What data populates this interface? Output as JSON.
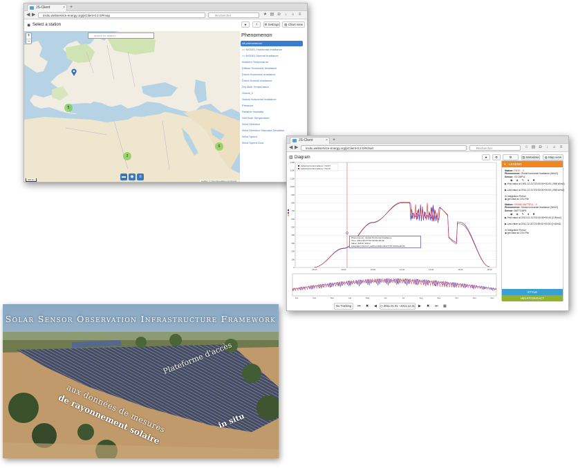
{
  "map_window": {
    "tab_title": "JS-Client",
    "url": "insitu.webservice-energy.org/jsClient-0.2.0/#map",
    "search_placeholder": "Rechercher",
    "header_title": "Select a station",
    "buttons": {
      "star": "★",
      "help": "?",
      "settings": "Settings",
      "chart_view": "Chart view"
    },
    "map_search_placeholder": "search for station...",
    "zoom_in": "+",
    "zoom_out": "−",
    "clusters": [
      "5",
      "2",
      "6"
    ],
    "attribution": "Leaflet | © OpenStreetMap contributors",
    "scale": "300 km",
    "phenomenon_title": "Phenomenon",
    "phenomena": [
      "All phenomenon",
      ">> MODEL Horizontal Irradiance",
      ">> MODEL Normal Irradiance",
      "Ambient Temperature",
      "Diffuse Horizontal Irradiance",
      "Direct Horizontal Irradiance",
      "Direct Normal Irradiance",
      "Dry Bulb Temperature",
      "Global_2",
      "Global Horizontal Irradiance",
      "Pressure",
      "Relative Humidity",
      "Wet Bulb Temperature",
      "Wind Direction",
      "Wind Direction Standard Deviation",
      "Wind Speed",
      "Wind Speed Gust"
    ]
  },
  "diagram_window": {
    "tab_title": "JS-Client",
    "url": "insitu.webservice-energy.org/jsClient-0.2.0/#chart",
    "search_placeholder": "Rechercher",
    "header_title": "Diagram",
    "buttons": {
      "star": "★",
      "gear": "⚙",
      "settings": "Settings",
      "metadata": "Metadata",
      "map_view": "Map view"
    },
    "legend_title": "LEGEND",
    "legend_bar2": "STYLE",
    "legend_bar3": "HELP/CONTACT",
    "legend_entries": [
      {
        "station_label": "Station:",
        "station": "ENTE - X",
        "phenomenon_label": "Phenomenon:",
        "phenomenon": "Global horizontal Irradiance (W/m2)",
        "sensor_label": "Sensor:",
        "sensor": "X3 CMP11",
        "first": "First value at 1991-12-31T23:00:00+00:00 (.998 W/m2)",
        "last": "Last value at 2014-12-31T23:00:00+00:00 (.998 W/m2)",
        "integration": "Integration Period",
        "csv": "get data as CSV-File"
      },
      {
        "station_label": "Station:",
        "station": "GRAND BATTEUL - X",
        "phenomenon_label": "Phenomenon:",
        "phenomenon": "Global horizontal Irradiance (W/m2)",
        "sensor_label": "Sensor:",
        "sensor": "BATTCMP6",
        "first": "First value at 2013-12-31T23:00:00+00:00 (0 W/m2)",
        "last": "Last value at 2011-12-31T23:59:00+00:00 (0 W/m2)",
        "integration": "Integration Period",
        "csv": "get data as CSV-File"
      }
    ],
    "chart_legend": [
      "Global Horizontal Irradiance = 519.87",
      "Global Horizontal Irradiance = 511.26"
    ],
    "tooltip": {
      "phenomenon": "Phenomenon: Global Horizontal Irradiance",
      "time": "Time: 2011-06-07T07:00:00+00:00",
      "value": "Value: 326.97 W/m2",
      "period": "Integration Period: yearfrom2011-06-07T07:00:00+00:00"
    },
    "y_unit": "W/m2",
    "bottom": {
      "no_tracking": "No Tracking",
      "range": "2011.01.01 - 2011.12.31"
    }
  },
  "chart_data": {
    "type": "line",
    "title": "",
    "ylabel": "W/m2",
    "ylim": [
      0,
      1300
    ],
    "yticks": [
      0,
      100,
      200,
      300,
      400,
      500,
      600,
      700,
      800,
      900,
      1000,
      1100,
      1200,
      1300
    ],
    "x": [
      "06:00",
      "08:00",
      "10:00",
      "12:00",
      "14:00",
      "16:00",
      "18:00"
    ],
    "series": [
      {
        "name": "Global Horizontal Irradiance = 519.87",
        "color": "#2b2bd6",
        "values": [
          5,
          240,
          560,
          800,
          790,
          560,
          10
        ]
      },
      {
        "name": "Global Horizontal Irradiance = 511.26",
        "color": "#d62b2b",
        "values": [
          5,
          235,
          555,
          810,
          800,
          540,
          10
        ]
      }
    ],
    "overview_months": [
      "Jan",
      "Feb",
      "Mar",
      "Apr",
      "May",
      "Jun",
      "Jul",
      "Aug",
      "Sep",
      "Oct",
      "Nov",
      "Dec"
    ]
  },
  "photo": {
    "title": "Solar Sensor Observation Infrastructure Framework",
    "line1": "Plateforme d'accès",
    "line2": "aux données de mesures",
    "line3": "de rayonnement solaire",
    "line4": "in situ"
  }
}
